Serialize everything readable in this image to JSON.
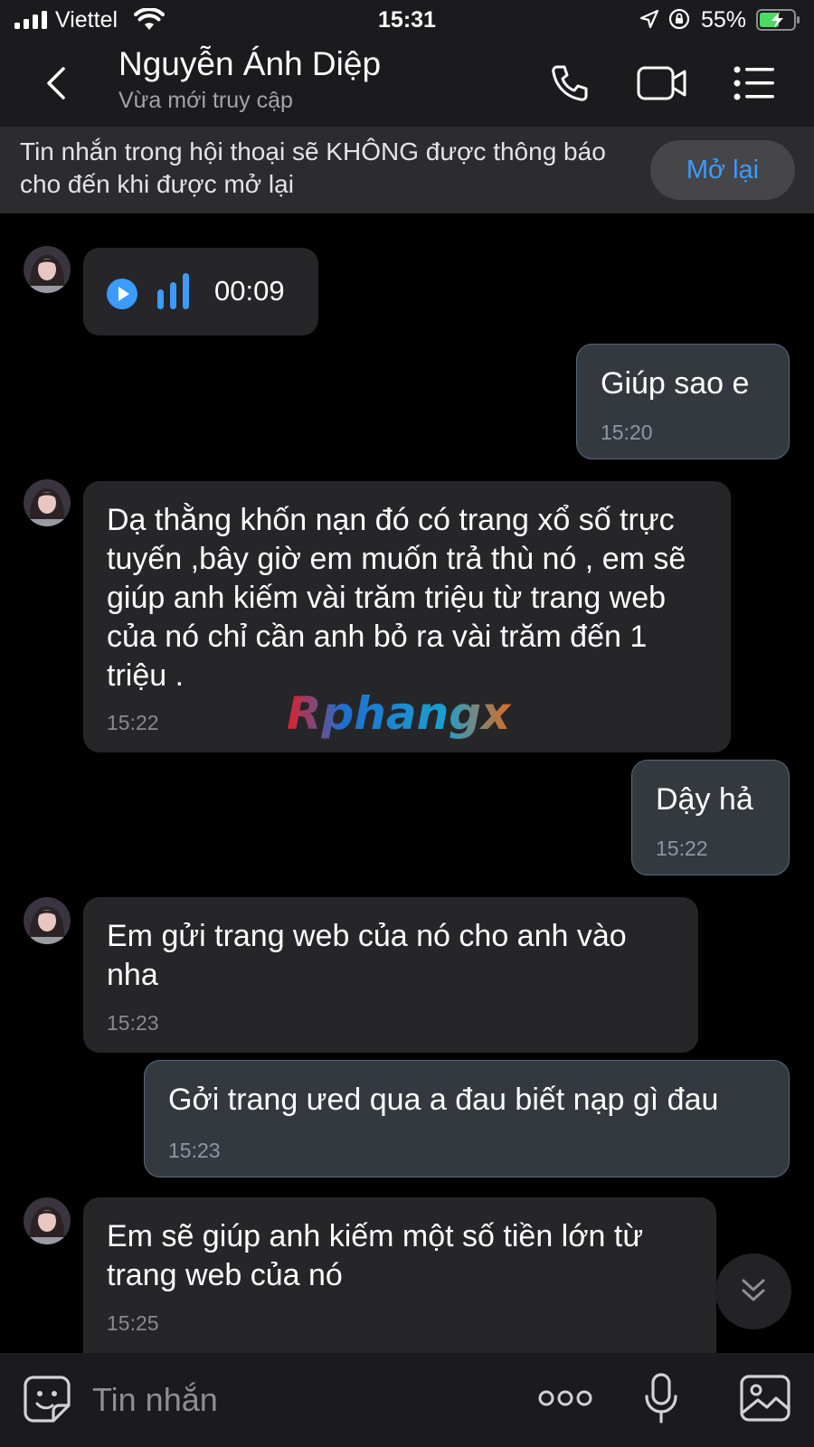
{
  "status_bar": {
    "carrier": "Viettel",
    "time": "15:31",
    "battery": "55%"
  },
  "header": {
    "name": "Nguyễn Ánh Diệp",
    "status": "Vừa mới truy cập"
  },
  "mute_banner": {
    "text": "Tin nhắn trong hội thoại sẽ KHÔNG được thông báo cho đến khi được mở lại",
    "button": "Mở lại"
  },
  "messages": [
    {
      "direction": "incoming",
      "type": "voice",
      "duration": "00:09"
    },
    {
      "direction": "outgoing",
      "text": "Giúp sao e",
      "time": "15:20"
    },
    {
      "direction": "incoming",
      "text": "Dạ thằng khốn nạn đó có trang xổ số trực tuyến ,bây giờ em muốn trả thù nó , em sẽ giúp anh kiếm vài trăm triệu từ trang web của nó chỉ cần anh bỏ ra vài trăm đến 1 triệu .",
      "time": "15:22"
    },
    {
      "direction": "outgoing",
      "text": "Dậy hả",
      "time": "15:22"
    },
    {
      "direction": "incoming",
      "text": "Em gửi trang web của nó cho anh vào nha",
      "time": "15:23"
    },
    {
      "direction": "outgoing",
      "text": "Gởi trang ưed qua a đau biết nạp gì đau",
      "time": "15:23"
    },
    {
      "direction": "incoming",
      "text": "Em sẽ giúp anh kiếm một số tiền lớn từ trang web của nó",
      "time": "15:25"
    }
  ],
  "watermark": "Rphangx",
  "input": {
    "placeholder": "Tin nhắn"
  },
  "colors": {
    "accent": "#3b9bff",
    "incoming_bubble": "#262628",
    "outgoing_bubble": "#34393f",
    "outgoing_border": "#566a80",
    "bar_background": "#1b1b1d"
  },
  "icons": [
    "signal-icon",
    "wifi-icon",
    "location-arrow-icon",
    "rotation-lock-icon",
    "battery-charging-icon",
    "back-chevron-icon",
    "phone-icon",
    "video-camera-icon",
    "menu-list-icon",
    "play-icon",
    "sound-wave-icon",
    "double-chevron-down-icon",
    "sticker-icon",
    "more-dots-icon",
    "microphone-icon",
    "image-icon"
  ]
}
